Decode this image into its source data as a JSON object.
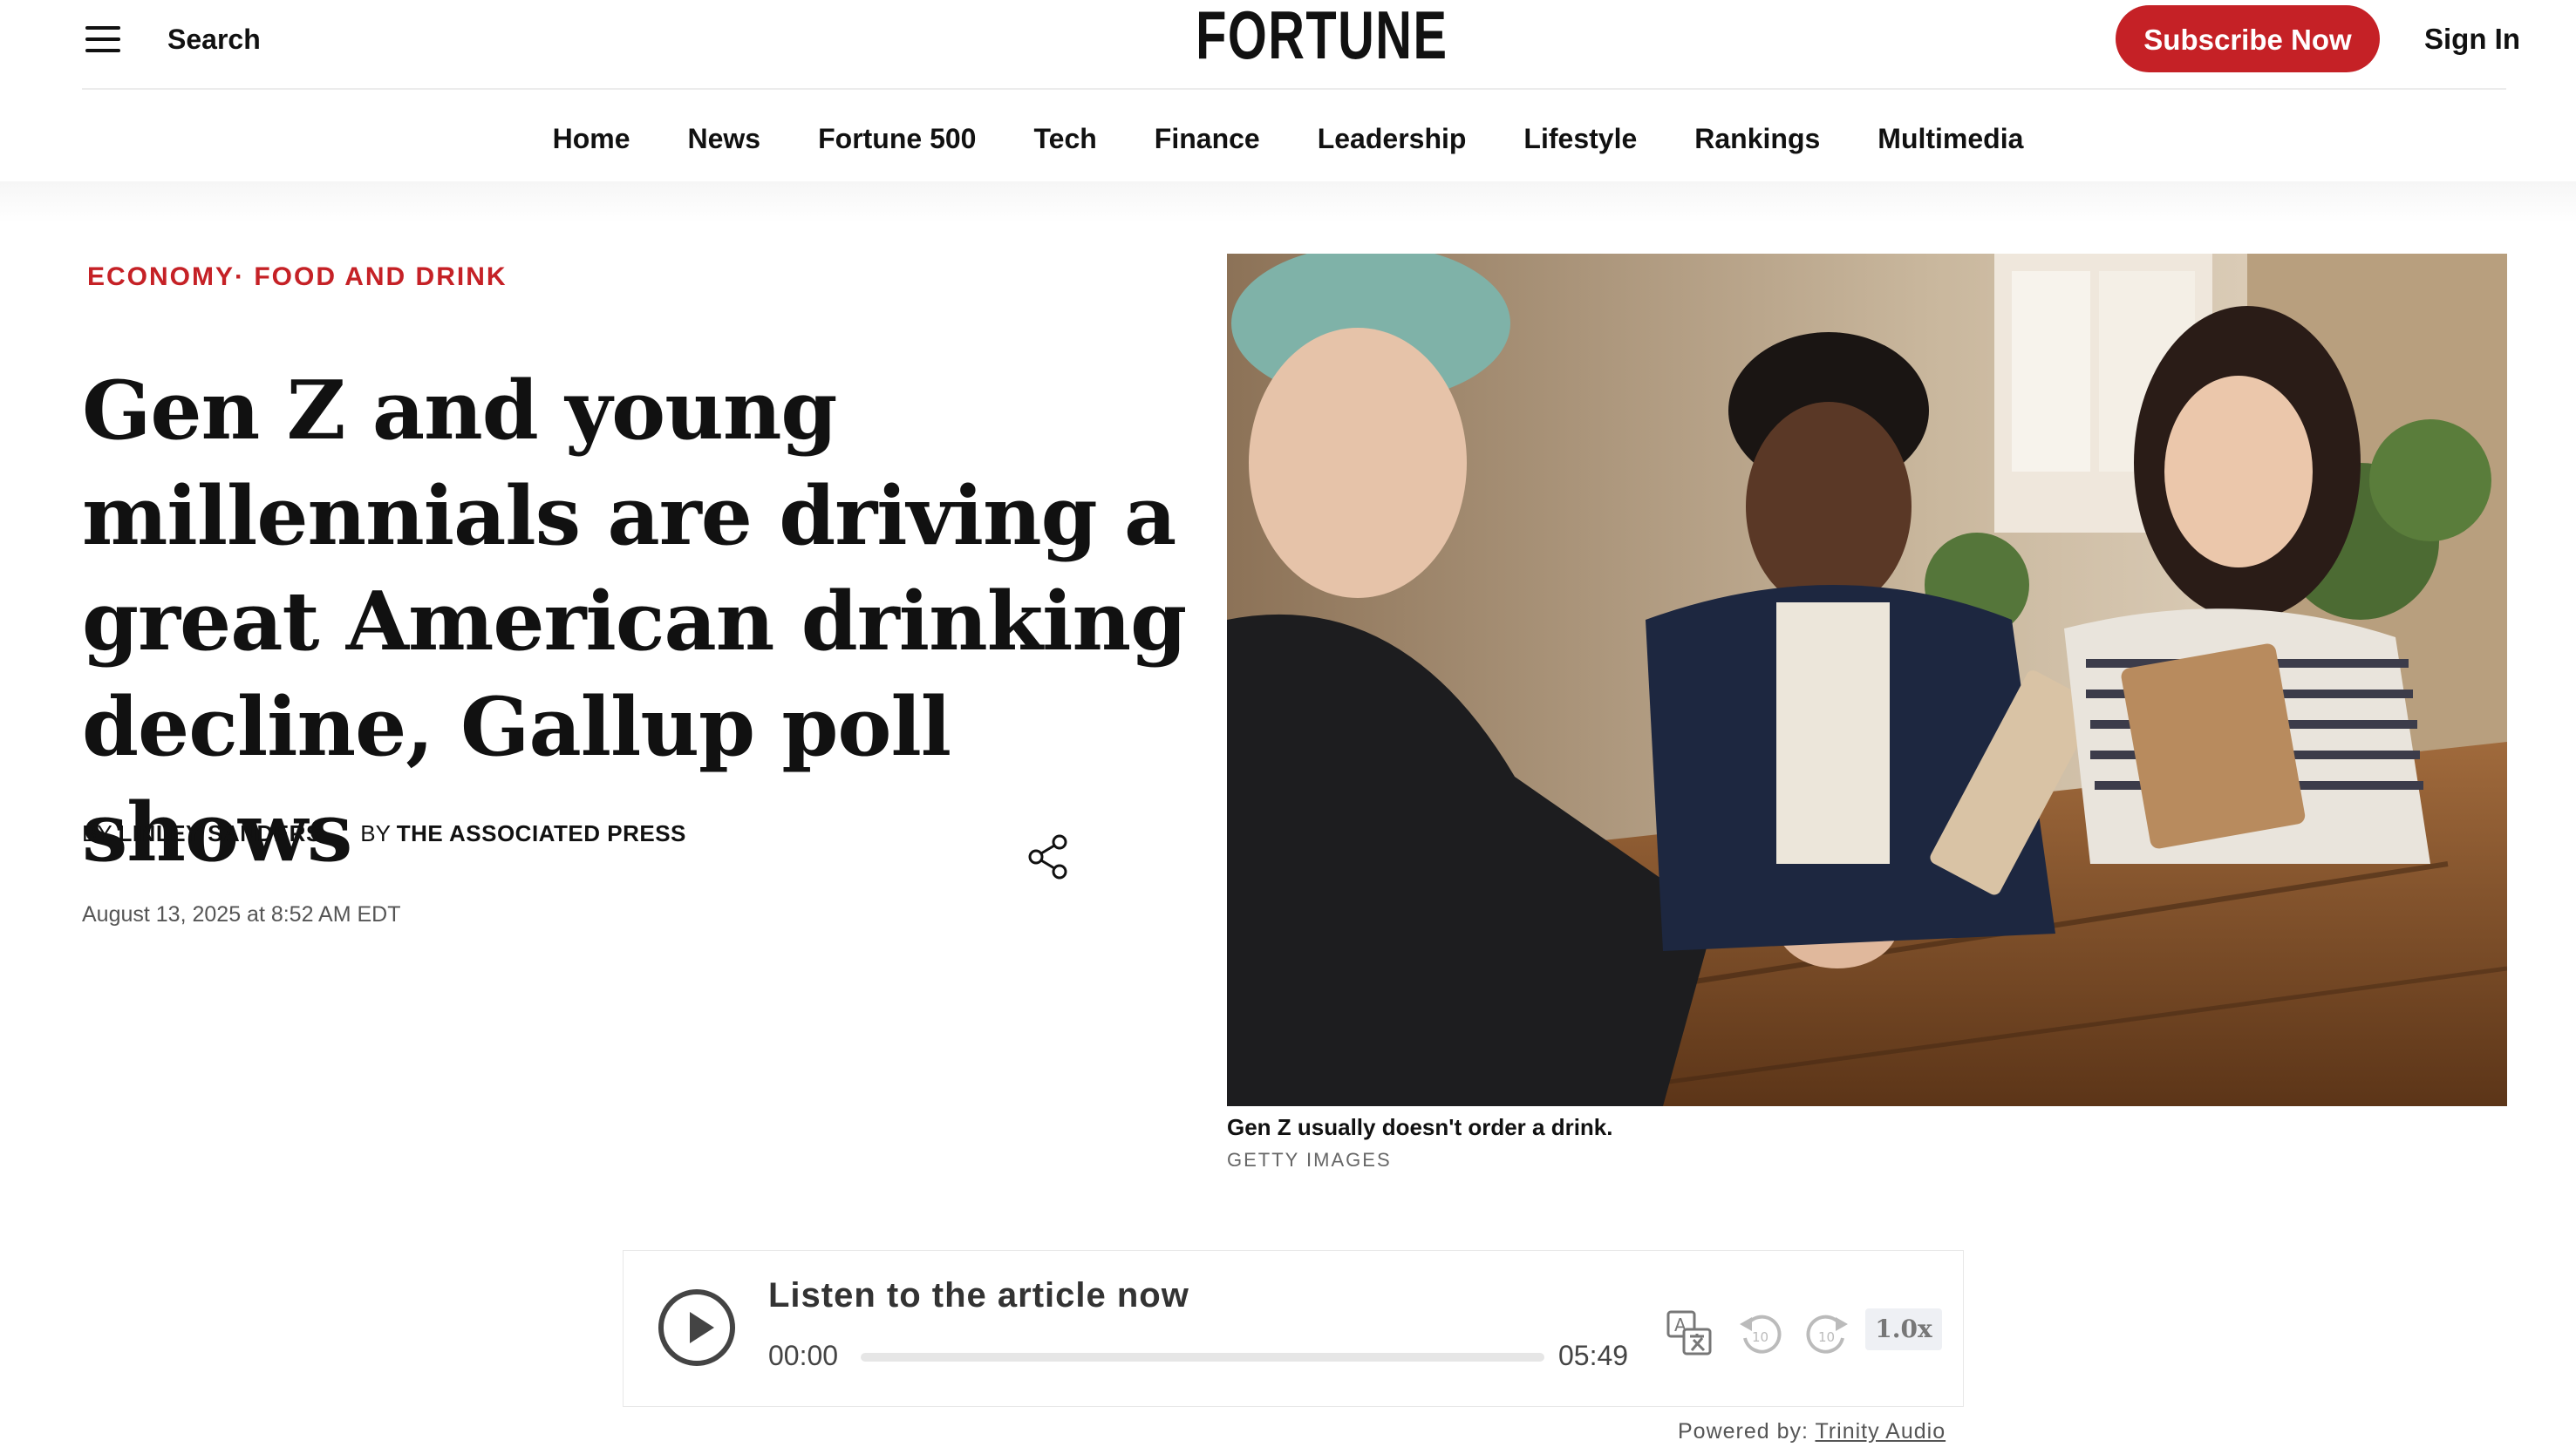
{
  "header": {
    "search_label": "Search",
    "logo_text": "FORTUNE",
    "subscribe_label": "Subscribe Now",
    "signin_label": "Sign In"
  },
  "nav": {
    "items": [
      "Home",
      "News",
      "Fortune 500",
      "Tech",
      "Finance",
      "Leadership",
      "Lifestyle",
      "Rankings",
      "Multimedia"
    ]
  },
  "article": {
    "section": "ECONOMY· FOOD AND DRINK",
    "headline": "Gen Z and young millennials are driving a great American drinking decline, Gallup poll shows",
    "by_prefix": "BY",
    "authors": [
      "LINLEY SANDERS",
      "THE ASSOCIATED PRESS"
    ],
    "date": "August 13, 2025 at 8:52 AM EDT",
    "image_caption": "Gen Z usually doesn't order a drink.",
    "image_credit": "GETTY IMAGES"
  },
  "audio_player": {
    "title": "Listen to the article now",
    "current_time": "00:00",
    "duration": "05:49",
    "progress": 0,
    "speed": "1.0x",
    "powered_by_prefix": "Powered by: ",
    "powered_by_link": "Trinity Audio"
  },
  "colors": {
    "brand_red": "#c52126",
    "text": "#111111",
    "muted": "#555555"
  },
  "icons": [
    "menu-icon",
    "share-icon",
    "play-icon",
    "translate-icon",
    "rewind-10-icon",
    "forward-10-icon"
  ]
}
